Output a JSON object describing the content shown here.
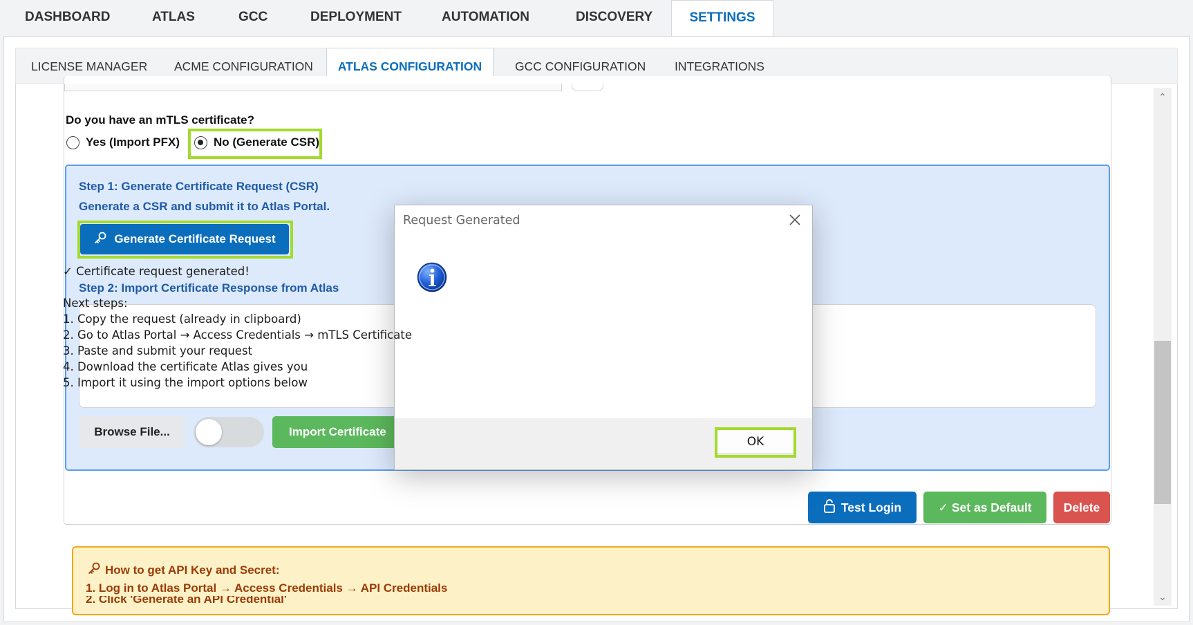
{
  "top_nav": {
    "tabs": [
      {
        "label": "DASHBOARD"
      },
      {
        "label": "ATLAS"
      },
      {
        "label": "GCC"
      },
      {
        "label": "DEPLOYMENT"
      },
      {
        "label": "AUTOMATION"
      },
      {
        "label": "DISCOVERY"
      },
      {
        "label": "SETTINGS"
      }
    ],
    "active": "SETTINGS"
  },
  "sub_nav": {
    "tabs": [
      {
        "label": "LICENSE MANAGER"
      },
      {
        "label": "ACME CONFIGURATION"
      },
      {
        "label": "ATLAS CONFIGURATION"
      },
      {
        "label": "GCC CONFIGURATION"
      },
      {
        "label": "INTEGRATIONS"
      }
    ],
    "active": "ATLAS CONFIGURATION"
  },
  "mtls": {
    "question": "Do you have an mTLS certificate?",
    "option_yes": "Yes (Import PFX)",
    "option_no": "No (Generate CSR)",
    "selected": "No (Generate CSR)"
  },
  "csr_panel": {
    "step1_title": "Step 1: Generate Certificate Request (CSR)",
    "step1_desc": "Generate a CSR and submit it to Atlas Portal.",
    "generate_button": "Generate Certificate Request",
    "step2_title": "Step 2: Import Certificate Response from Atlas",
    "response_value": "",
    "browse_button": "Browse File...",
    "toggle_on": false,
    "import_button": "Import Certificate"
  },
  "actions": {
    "test_login": "Test Login",
    "set_default": "✓ Set as Default",
    "delete": "Delete"
  },
  "help": {
    "title": "How to get API Key and Secret:",
    "lines": [
      "1. Log in to Atlas Portal → Access Credentials → API Credentials",
      "2. Click 'Generate an API Credential'"
    ]
  },
  "dialog": {
    "title": "Request Generated",
    "icon": "info-icon",
    "message_lines": [
      "✓ Certificate request generated!",
      "",
      "Next steps:",
      "1. Copy the request (already in clipboard)",
      "2. Go to Atlas Portal → Access Credentials → mTLS Certificate",
      "3. Paste and submit your request",
      "4. Download the certificate Atlas gives you",
      "5. Import it using the import options below"
    ],
    "ok_button": "OK"
  },
  "colors": {
    "accent_blue": "#0a6ebd",
    "success_green": "#5cb85c",
    "danger_red": "#d9534f",
    "highlight": "#a3da2e",
    "panel_bg": "#ddeafc",
    "help_bg": "#fdf2c7"
  }
}
